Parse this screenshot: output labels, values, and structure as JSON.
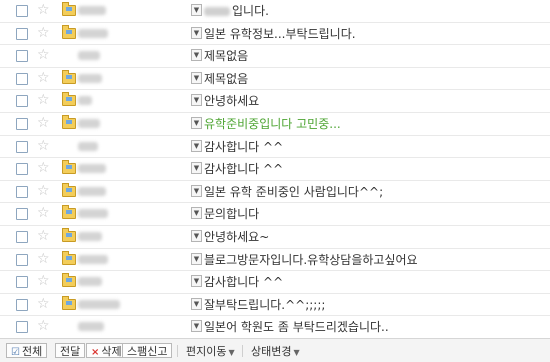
{
  "messages": [
    {
      "subject": "입니다.",
      "subject_prefix_blurred": true,
      "starred": false,
      "folder_icon": true,
      "color": "normal"
    },
    {
      "subject": "일본 유학정보...부탁드립니다.",
      "starred": false,
      "folder_icon": true,
      "color": "normal"
    },
    {
      "subject": "제목없음",
      "starred": false,
      "folder_icon": false,
      "color": "normal"
    },
    {
      "subject": "제목없음",
      "starred": false,
      "folder_icon": true,
      "color": "normal"
    },
    {
      "subject": "안녕하세요",
      "starred": false,
      "folder_icon": true,
      "color": "normal"
    },
    {
      "subject": "유학준비중입니다 고민중...",
      "starred": false,
      "folder_icon": true,
      "color": "green"
    },
    {
      "subject": "감사합니다 ^^",
      "starred": false,
      "folder_icon": false,
      "color": "normal"
    },
    {
      "subject": "감사합니다 ^^",
      "starred": false,
      "folder_icon": true,
      "color": "normal"
    },
    {
      "subject": "일본 유학 준비중인 사람입니다^^;",
      "starred": false,
      "folder_icon": true,
      "color": "normal"
    },
    {
      "subject": "문의합니다",
      "starred": false,
      "folder_icon": true,
      "color": "normal"
    },
    {
      "subject": "안녕하세요~",
      "starred": false,
      "folder_icon": true,
      "color": "normal"
    },
    {
      "subject": "블로그방문자입니다.유학상담을하고싶어요",
      "starred": false,
      "folder_icon": true,
      "color": "normal"
    },
    {
      "subject": "감사합니다 ^^",
      "starred": false,
      "folder_icon": true,
      "color": "normal"
    },
    {
      "subject": "잘부탁드립니다.^^;;;;;",
      "starred": false,
      "folder_icon": true,
      "color": "normal"
    },
    {
      "subject": "일본어 학원도 좀 부탁드리겠습니다..",
      "starred": false,
      "folder_icon": false,
      "color": "normal"
    }
  ],
  "toolbar": {
    "select_all_label": "전체",
    "forward_label": "전달",
    "delete_label": "삭제",
    "spam_label": "스팸신고",
    "move_label": "편지이동",
    "status_label": "상태변경"
  },
  "colors": {
    "highlight_subject": "#4ea533",
    "folder_icon": "#f3cd5a",
    "checkbox_border": "#8ea6bf",
    "delete_icon": "#d9332e"
  },
  "icons": {
    "checkbox": "checkbox-icon",
    "star": "star-icon",
    "folder": "folder-icon",
    "expand": "expand-arrow-icon",
    "delete": "x-icon",
    "dropdown": "chevron-down-icon"
  }
}
